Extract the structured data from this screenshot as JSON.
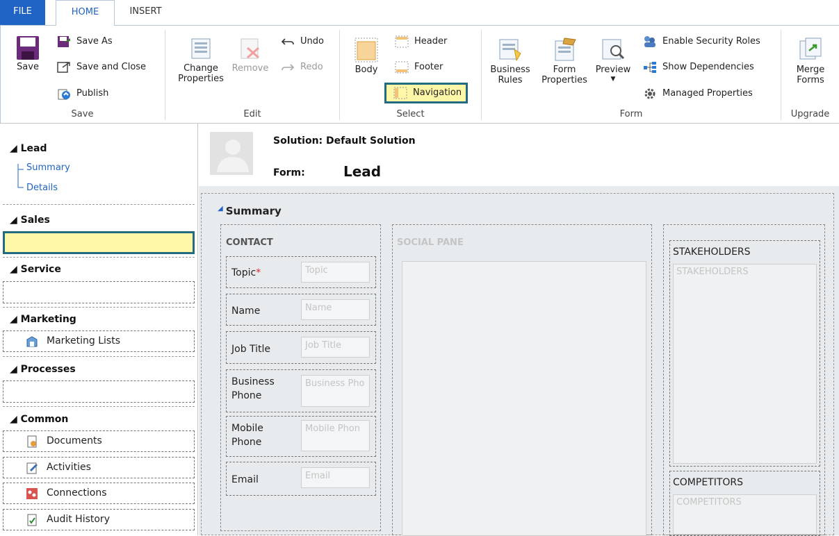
{
  "tabs": {
    "file": "FILE",
    "home": "HOME",
    "insert": "INSERT"
  },
  "ribbon": {
    "save_group": {
      "label": "Save",
      "save": "Save",
      "save_as": "Save As",
      "save_and_close": "Save and Close",
      "publish": "Publish"
    },
    "edit_group": {
      "label": "Edit",
      "change_properties_1": "Change",
      "change_properties_2": "Properties",
      "remove": "Remove",
      "undo": "Undo",
      "redo": "Redo"
    },
    "select_group": {
      "label": "Select",
      "body": "Body",
      "header": "Header",
      "footer": "Footer",
      "navigation": "Navigation"
    },
    "form_group": {
      "label": "Form",
      "business_rules_1": "Business",
      "business_rules_2": "Rules",
      "form_properties_1": "Form",
      "form_properties_2": "Properties",
      "preview": "Preview",
      "enable_security_roles": "Enable Security Roles",
      "show_dependencies": "Show Dependencies",
      "managed_properties": "Managed Properties"
    },
    "upgrade_group": {
      "label": "Upgrade",
      "merge_forms_1": "Merge",
      "merge_forms_2": "Forms"
    }
  },
  "leftnav": {
    "lead": {
      "title": "Lead",
      "links": [
        "Summary",
        "Details"
      ]
    },
    "sales": {
      "title": "Sales"
    },
    "service": {
      "title": "Service"
    },
    "marketing": {
      "title": "Marketing",
      "items": [
        "Marketing Lists"
      ]
    },
    "processes": {
      "title": "Processes"
    },
    "common": {
      "title": "Common",
      "items": [
        "Documents",
        "Activities",
        "Connections",
        "Audit History"
      ]
    }
  },
  "form": {
    "solution_label": "Solution: Default Solution",
    "form_label": "Form:",
    "form_name": "Lead",
    "tab_title": "Summary",
    "contact_section": {
      "title": "CONTACT",
      "fields": [
        {
          "label": "Topic",
          "required": "*",
          "placeholder": "Topic"
        },
        {
          "label": "Name",
          "placeholder": "Name"
        },
        {
          "label": "Job Title",
          "placeholder": "Job Title"
        },
        {
          "label_1": "Business",
          "label_2": "Phone",
          "placeholder": "Business Pho"
        },
        {
          "label_1": "Mobile",
          "label_2": "Phone",
          "placeholder": "Mobile Phon"
        },
        {
          "label": "Email",
          "placeholder": "Email"
        }
      ]
    },
    "social_pane": {
      "title": "SOCIAL PANE"
    },
    "stakeholders": {
      "title": "STAKEHOLDERS",
      "placeholder": "STAKEHOLDERS"
    },
    "competitors": {
      "title": "COMPETITORS",
      "placeholder": "COMPETITORS"
    }
  },
  "colors": {
    "accent": "#1f64c4",
    "highlight": "#fff7a8",
    "highlight_border": "#226a82"
  }
}
